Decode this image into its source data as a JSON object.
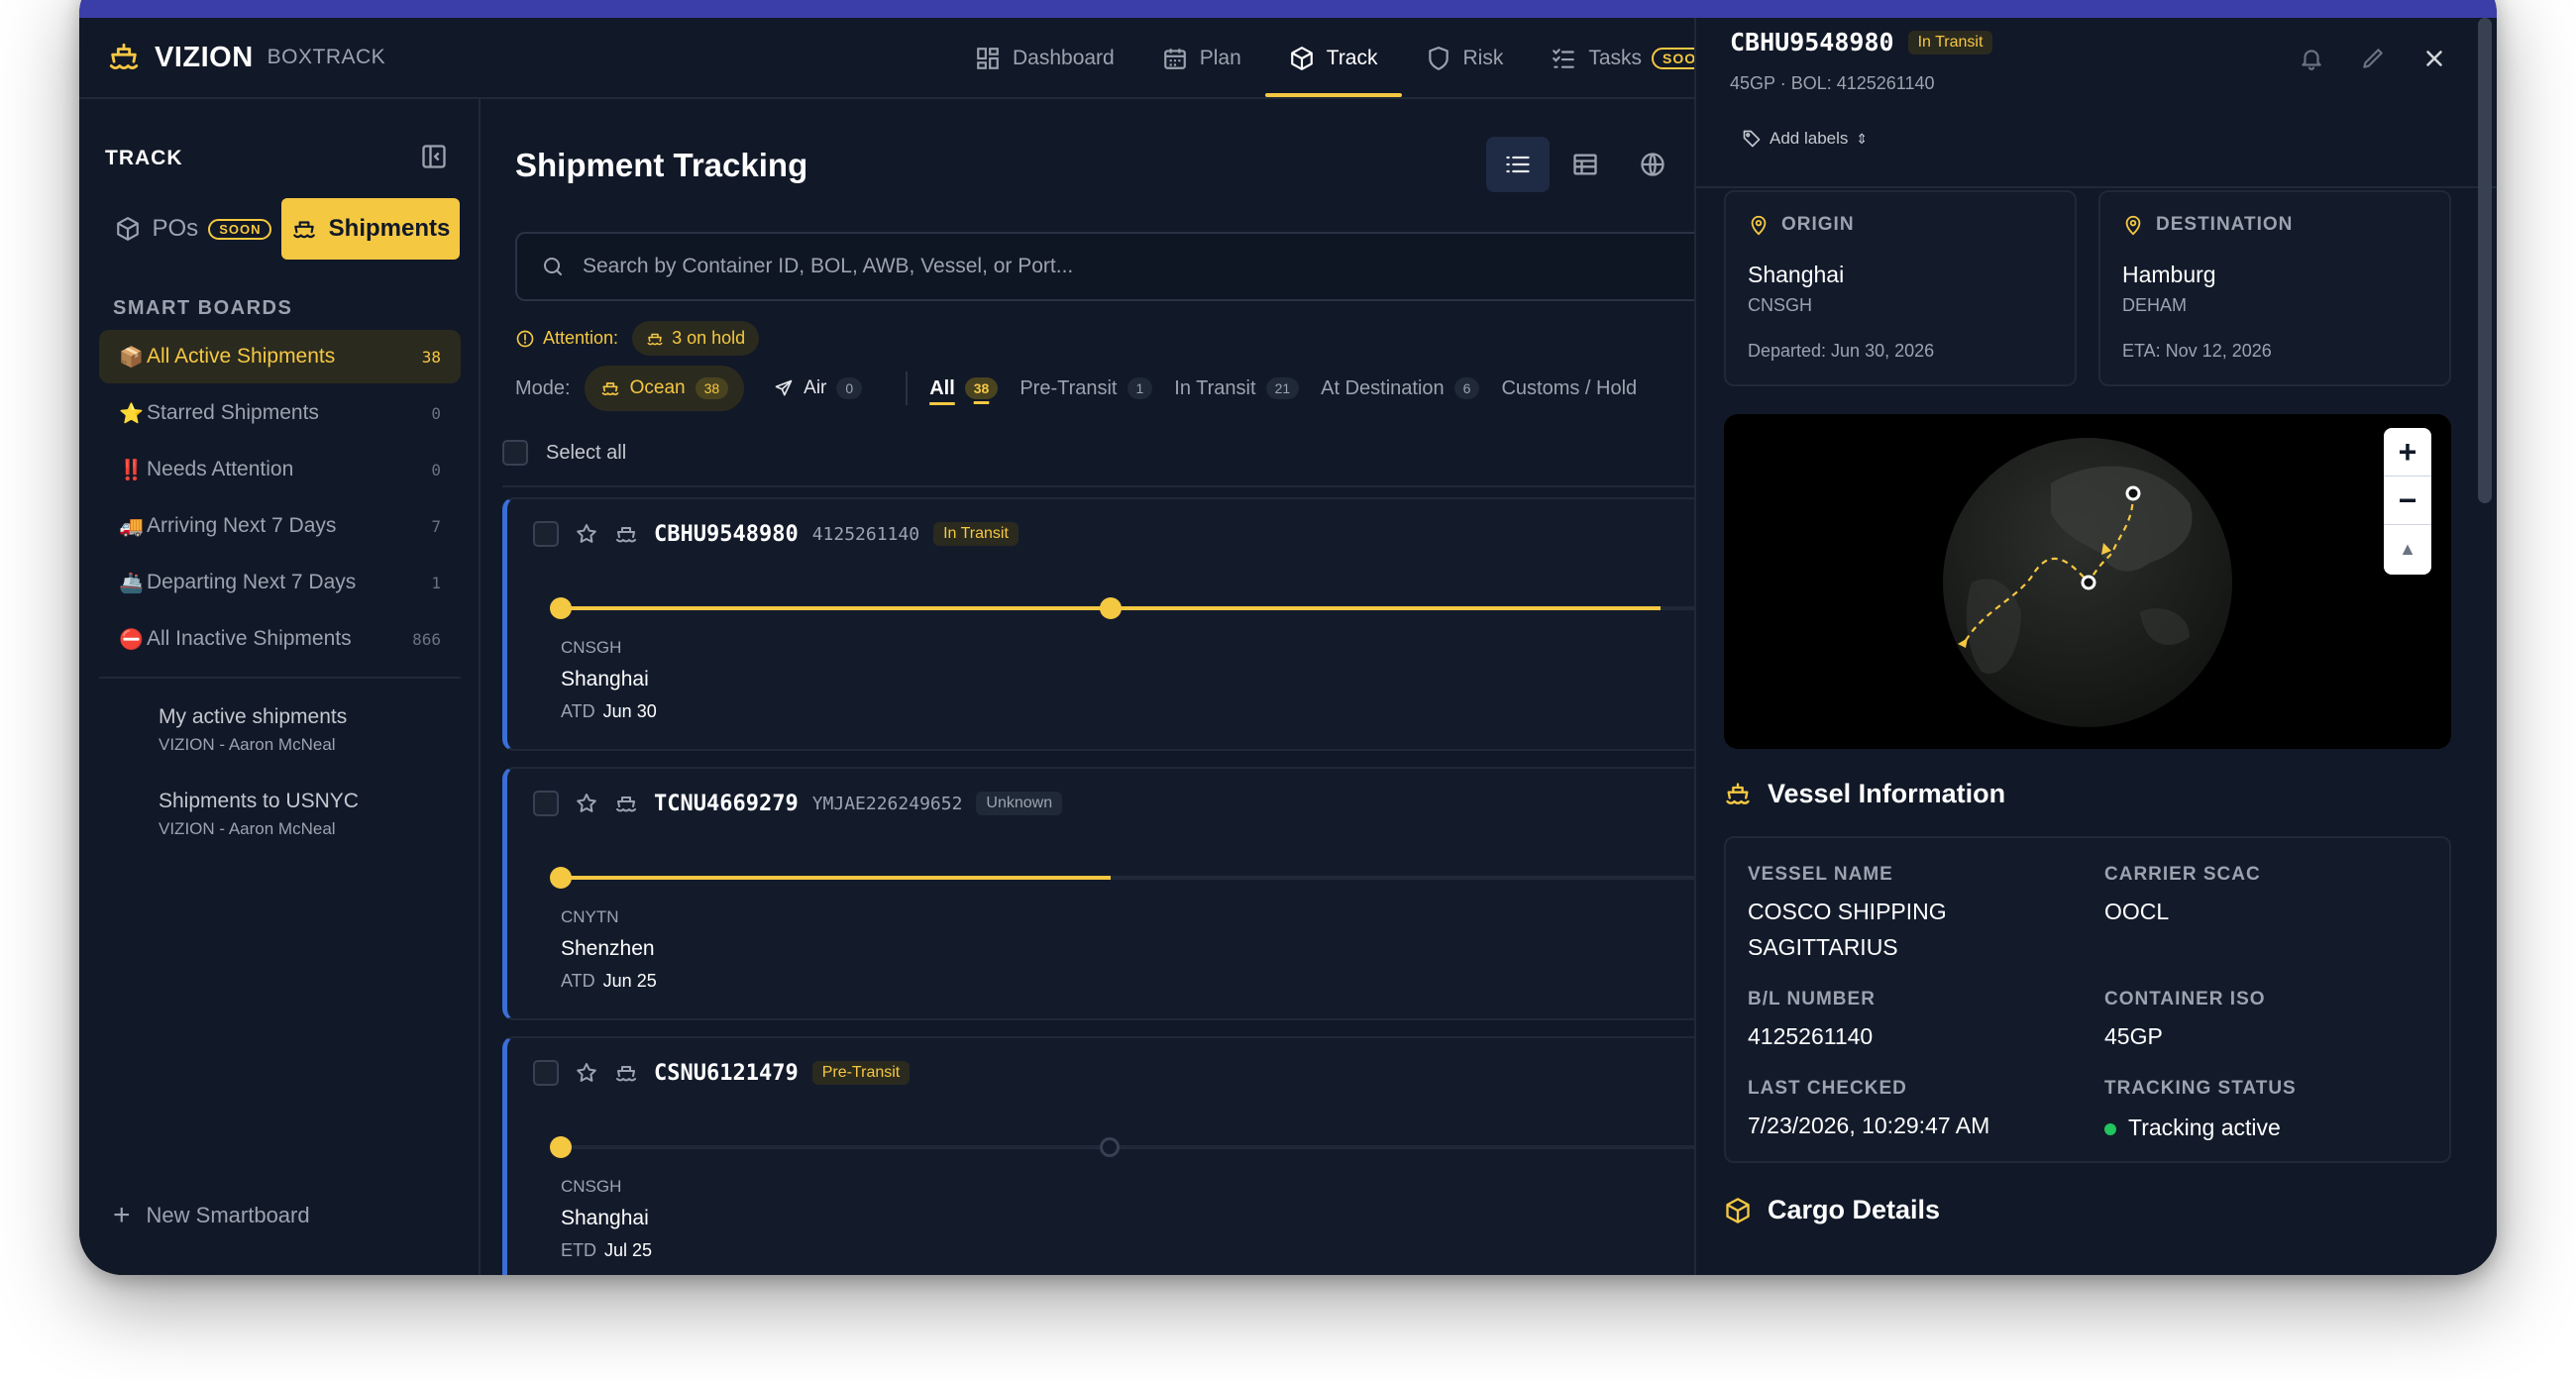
{
  "app": {
    "name": "VIZION",
    "product": "BOXTRACK"
  },
  "nav": [
    {
      "label": "Dashboard",
      "icon": "dashboard-icon"
    },
    {
      "label": "Plan",
      "icon": "calendar-icon"
    },
    {
      "label": "Track",
      "icon": "box-icon",
      "active": true
    },
    {
      "label": "Risk",
      "icon": "shield-icon"
    },
    {
      "label": "Tasks",
      "icon": "tasks-icon",
      "badge": "SOON"
    }
  ],
  "sidebar": {
    "title": "TRACK",
    "tabs": {
      "pos": "POs",
      "pos_badge": "SOON",
      "shipments": "Shipments"
    },
    "smart_boards_title": "SMART BOARDS",
    "boards": [
      {
        "emoji": "📦",
        "label": "All Active Shipments",
        "count": "38",
        "selected": true
      },
      {
        "emoji": "⭐",
        "label": "Starred Shipments",
        "count": "0"
      },
      {
        "emoji": "‼️",
        "label": "Needs Attention",
        "count": "0"
      },
      {
        "emoji": "🚚",
        "label": "Arriving Next 7 Days",
        "count": "7"
      },
      {
        "emoji": "🚢",
        "label": "Departing Next 7 Days",
        "count": "1"
      },
      {
        "emoji": "⛔",
        "label": "All Inactive Shipments",
        "count": "866"
      }
    ],
    "saved_views": [
      {
        "label": "My active shipments",
        "owner": "VIZION - Aaron McNeal"
      },
      {
        "label": "Shipments to USNYC",
        "owner": "VIZION - Aaron McNeal"
      }
    ],
    "new_board": "New Smartboard"
  },
  "main": {
    "title": "Shipment Tracking",
    "search_placeholder": "Search by Container ID, BOL, AWB, Vessel, or Port...",
    "attention_label": "Attention:",
    "attention_pill": "3 on hold",
    "mode_label": "Mode:",
    "modes": [
      {
        "label": "Ocean",
        "count": "38",
        "active": true
      },
      {
        "label": "Air",
        "count": "0"
      }
    ],
    "status_tabs": [
      {
        "label": "All",
        "count": "38",
        "active": true
      },
      {
        "label": "Pre-Transit",
        "count": "1"
      },
      {
        "label": "In Transit",
        "count": "21"
      },
      {
        "label": "At Destination",
        "count": "6"
      },
      {
        "label": "Customs / Hold",
        "count": ""
      }
    ],
    "select_all": "Select all",
    "shipments": [
      {
        "id": "CBHU9548980",
        "ref": "4125261140",
        "status": "In Transit",
        "status_kind": "transit",
        "origin_code": "CNSGH",
        "origin_city": "Shanghai",
        "date_label": "ATD",
        "date": "Jun 30",
        "progress": 1.0
      },
      {
        "id": "TCNU4669279",
        "ref": "YMJAE226249652",
        "status": "Unknown",
        "status_kind": "unknown",
        "origin_code": "CNYTN",
        "origin_city": "Shenzhen",
        "date_label": "ATD",
        "date": "Jun 25",
        "progress": 0.5
      },
      {
        "id": "CSNU6121479",
        "ref": "",
        "status": "Pre-Transit",
        "status_kind": "pre",
        "origin_code": "CNSGH",
        "origin_city": "Shanghai",
        "date_label": "ETD",
        "date": "Jul 25",
        "progress": 0.0
      }
    ]
  },
  "detail": {
    "id": "CBHU9548980",
    "status": "In Transit",
    "subtitle": "45GP · BOL: 4125261140",
    "add_labels": "Add labels",
    "origin": {
      "heading": "ORIGIN",
      "city": "Shanghai",
      "code": "CNSGH",
      "when": "Departed: Jun 30, 2026"
    },
    "destination": {
      "heading": "DESTINATION",
      "city": "Hamburg",
      "code": "DEHAM",
      "when": "ETA: Nov 12, 2026"
    },
    "vessel_title": "Vessel Information",
    "vessel": {
      "vessel_name_label": "VESSEL NAME",
      "vessel_name": "COSCO SHIPPING SAGITTARIUS",
      "carrier_scac_label": "CARRIER SCAC",
      "carrier_scac": "OOCL",
      "bl_label": "B/L NUMBER",
      "bl": "4125261140",
      "iso_label": "CONTAINER ISO",
      "iso": "45GP",
      "checked_label": "LAST CHECKED",
      "checked": "7/23/2026, 10:29:47 AM",
      "status_label": "TRACKING STATUS",
      "status": "Tracking active"
    },
    "cargo_title": "Cargo Details",
    "map_controls": {
      "zoom_in": "+",
      "zoom_out": "−",
      "reset": "▲"
    }
  },
  "colors": {
    "accent": "#f5c842",
    "bg": "#111827",
    "active_green": "#22c55e",
    "card_border": "#3b6fd8"
  }
}
